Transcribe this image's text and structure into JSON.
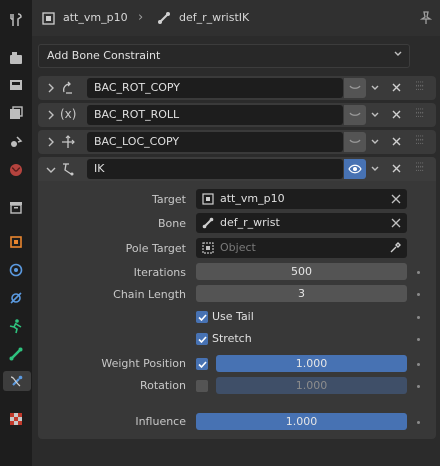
{
  "header": {
    "object_name": "att_vm_p10",
    "bone_name": "def_r_wristIK"
  },
  "add_constraint_label": "Add Bone Constraint",
  "constraints": [
    {
      "name": "BAC_ROT_COPY"
    },
    {
      "name": "BAC_ROT_ROLL",
      "type_icon_text": "(x)"
    },
    {
      "name": "BAC_LOC_COPY"
    },
    {
      "name": "IK"
    }
  ],
  "ik": {
    "target_label": "Target",
    "target_value": "att_vm_p10",
    "bone_label": "Bone",
    "bone_value": "def_r_wrist",
    "pole_target_label": "Pole Target",
    "pole_target_placeholder": "Object",
    "iterations_label": "Iterations",
    "iterations_value": "500",
    "chain_length_label": "Chain Length",
    "chain_length_value": "3",
    "use_tail_label": "Use Tail",
    "stretch_label": "Stretch",
    "weight_position_label": "Weight Position",
    "weight_position_value": "1.000",
    "rotation_label": "Rotation",
    "rotation_value": "1.000",
    "influence_label": "Influence",
    "influence_value": "1.000"
  }
}
